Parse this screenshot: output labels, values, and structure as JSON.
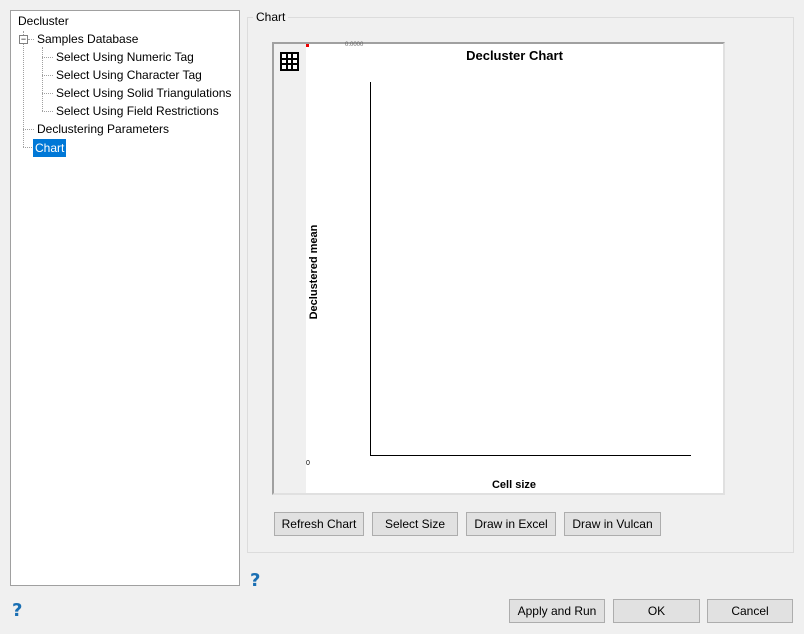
{
  "tree": {
    "root": "Decluster",
    "items": [
      "Samples Database",
      "Select Using Numeric Tag",
      "Select Using Character Tag",
      "Select Using Solid Triangulations",
      "Select Using Field Restrictions",
      "Declustering Parameters",
      "Chart"
    ]
  },
  "group_label": "Chart",
  "chart": {
    "title": "Decluster Chart",
    "xlabel": "Cell size",
    "ylabel": "Declustered mean",
    "y_zero": "0",
    "top_value": "0.0000"
  },
  "buttons": {
    "refresh": "Refresh Chart",
    "select_size": "Select Size",
    "excel": "Draw in Excel",
    "vulcan": "Draw in Vulcan",
    "apply": "Apply and Run",
    "ok": "OK",
    "cancel": "Cancel"
  },
  "help": "?"
}
